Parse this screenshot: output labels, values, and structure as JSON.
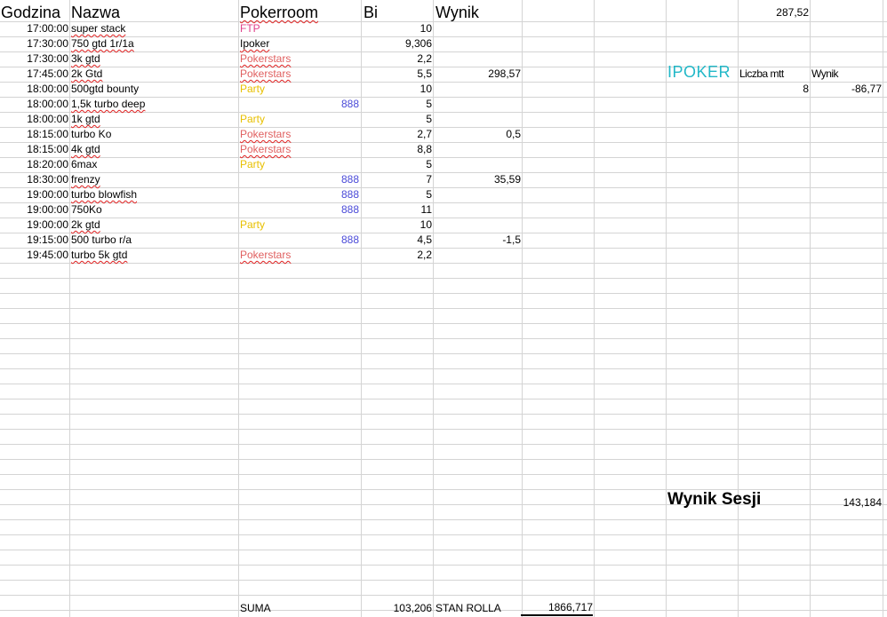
{
  "colors": {
    "gridline": "#d4d4d4",
    "ftp": "#e0408a",
    "pokerstars": "#e06060",
    "party": "#e8c000",
    "888": "#4a4ad8",
    "ipoker_label": "#22b8c8"
  },
  "headers": {
    "godzina": "Godzina",
    "nazwa": "Nazwa",
    "pokerroom": "Pokerroom",
    "bi": "Bi",
    "wynik": "Wynik"
  },
  "rows": [
    {
      "time": "17:00:00",
      "name": "super stack",
      "room": "FTP",
      "room_type": "ftp",
      "bi": "10",
      "result": ""
    },
    {
      "time": "17:30:00",
      "name": "750 gtd 1r/1a",
      "room": "Ipoker",
      "room_type": "ipoker",
      "bi": "9,306",
      "result": ""
    },
    {
      "time": "17:30:00",
      "name": "3k gtd",
      "room": "Pokerstars",
      "room_type": "pokerstars",
      "bi": "2,2",
      "result": ""
    },
    {
      "time": "17:45:00",
      "name": "2k Gtd",
      "room": "Pokerstars",
      "room_type": "pokerstars",
      "bi": "5,5",
      "result": "298,57"
    },
    {
      "time": "18:00:00",
      "name": "500gtd bounty",
      "room": "Party",
      "room_type": "party",
      "bi": "10",
      "result": ""
    },
    {
      "time": "18:00:00",
      "name": "1,5k turbo deep",
      "room": "888",
      "room_type": "888",
      "bi": "5",
      "result": ""
    },
    {
      "time": "18:00:00",
      "name": "1k gtd",
      "room": "Party",
      "room_type": "party",
      "bi": "5",
      "result": ""
    },
    {
      "time": "18:15:00",
      "name": "turbo Ko",
      "room": "Pokerstars",
      "room_type": "pokerstars",
      "bi": "2,7",
      "result": "0,5"
    },
    {
      "time": "18:15:00",
      "name": "4k gtd",
      "room": "Pokerstars",
      "room_type": "pokerstars",
      "bi": "8,8",
      "result": ""
    },
    {
      "time": "18:20:00",
      "name": "6max",
      "room": "Party",
      "room_type": "party",
      "bi": "5",
      "result": ""
    },
    {
      "time": "18:30:00",
      "name": "frenzy",
      "room": "888",
      "room_type": "888",
      "bi": "7",
      "result": "35,59"
    },
    {
      "time": "19:00:00",
      "name": "turbo blowfish",
      "room": "888",
      "room_type": "888",
      "bi": "5",
      "result": ""
    },
    {
      "time": "19:00:00",
      "name": "750Ko",
      "room": "888",
      "room_type": "888",
      "bi": "11",
      "result": ""
    },
    {
      "time": "19:00:00",
      "name": "2k gtd",
      "room": "Party",
      "room_type": "party",
      "bi": "10",
      "result": ""
    },
    {
      "time": "19:15:00",
      "name": "500 turbo r/a",
      "room": "888",
      "room_type": "888",
      "bi": "4,5",
      "result": "-1,5"
    },
    {
      "time": "19:45:00",
      "name": "turbo 5k gtd",
      "room": "Pokerstars",
      "room_type": "pokerstars",
      "bi": "2,2",
      "result": ""
    }
  ],
  "squiggle_names": [
    "super stack",
    "750 gtd 1r/1a",
    "3k gtd",
    "2k Gtd",
    "1,5k turbo deep",
    "1k gtd",
    "4k gtd",
    "frenzy",
    "turbo blowfish",
    "2k gtd",
    "turbo 5k gtd"
  ],
  "top_right_value": "287,52",
  "ipoker_summary": {
    "label": "IPOKER",
    "count_header": "Liczba mtt",
    "result_header": "Wynik",
    "count": "8",
    "result": "-86,77"
  },
  "session": {
    "label": "Wynik Sesji",
    "value": "143,184"
  },
  "footer": {
    "suma_label": "SUMA",
    "suma_value": "103,206",
    "stan_label": "STAN ROLLA",
    "stan_value": "1866,717"
  }
}
